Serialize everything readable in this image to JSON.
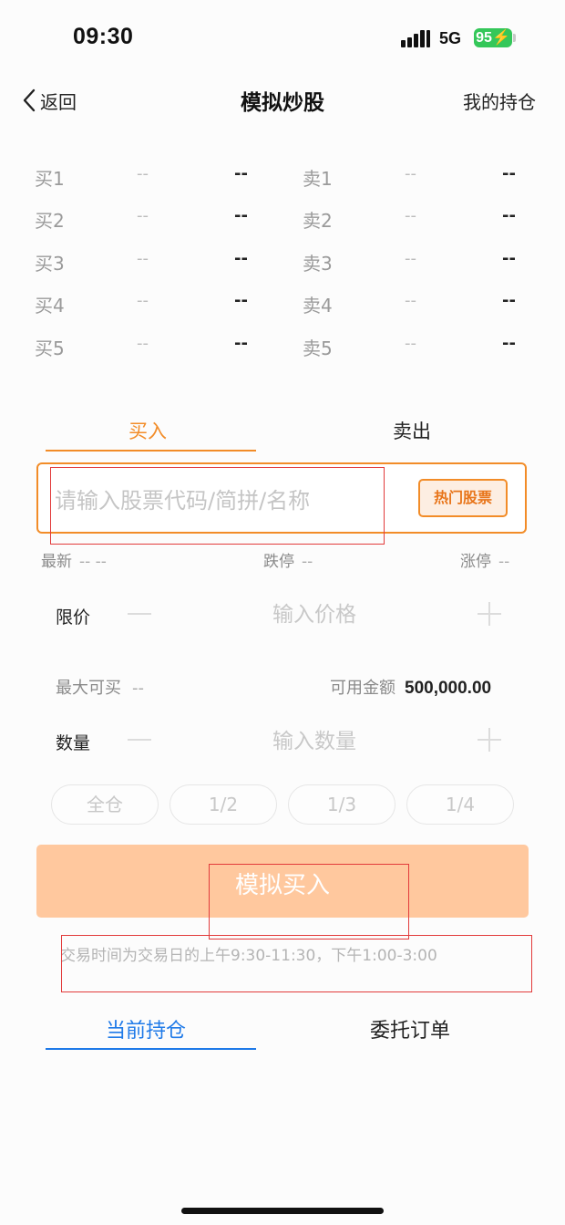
{
  "status_bar": {
    "time": "09:30",
    "network": "5G",
    "battery": "95"
  },
  "nav": {
    "back_label": "返回",
    "title": "模拟炒股",
    "right_label": "我的持仓"
  },
  "order_book": {
    "buy": [
      {
        "label": "买1",
        "price": "--",
        "volume": "--"
      },
      {
        "label": "买2",
        "price": "--",
        "volume": "--"
      },
      {
        "label": "买3",
        "price": "--",
        "volume": "--"
      },
      {
        "label": "买4",
        "price": "--",
        "volume": "--"
      },
      {
        "label": "买5",
        "price": "--",
        "volume": "--"
      }
    ],
    "sell": [
      {
        "label": "卖1",
        "price": "--",
        "volume": "--"
      },
      {
        "label": "卖2",
        "price": "--",
        "volume": "--"
      },
      {
        "label": "卖3",
        "price": "--",
        "volume": "--"
      },
      {
        "label": "卖4",
        "price": "--",
        "volume": "--"
      },
      {
        "label": "卖5",
        "price": "--",
        "volume": "--"
      }
    ]
  },
  "trade_tabs": {
    "buy": "买入",
    "sell": "卖出",
    "active": "buy"
  },
  "search": {
    "placeholder": "请输入股票代码/简拼/名称",
    "value": "",
    "hot_button": "热门股票"
  },
  "quote": {
    "latest_label": "最新",
    "latest_value": "-- --",
    "limit_down_label": "跌停",
    "limit_down_value": "--",
    "limit_up_label": "涨停",
    "limit_up_value": "--"
  },
  "price": {
    "label": "限价",
    "placeholder": "输入价格",
    "value": ""
  },
  "info": {
    "max_buy_label": "最大可买",
    "max_buy_value": "--",
    "available_label": "可用金额",
    "available_value": "500,000.00"
  },
  "quantity": {
    "label": "数量",
    "placeholder": "输入数量",
    "value": ""
  },
  "position_options": [
    "全仓",
    "1/2",
    "1/3",
    "1/4"
  ],
  "submit": {
    "label": "模拟买入"
  },
  "trading_note": "交易时间为交易日的上午9:30-11:30，下午1:00-3:00",
  "bottom_tabs": {
    "current_holdings": "当前持仓",
    "orders": "委托订单",
    "active": "current_holdings"
  },
  "colors": {
    "accent_orange": "#f28c28",
    "button_orange": "#ffc89e",
    "blue": "#1f7ae8",
    "highlight_red": "#e23b3b",
    "battery_green": "#34c759"
  }
}
